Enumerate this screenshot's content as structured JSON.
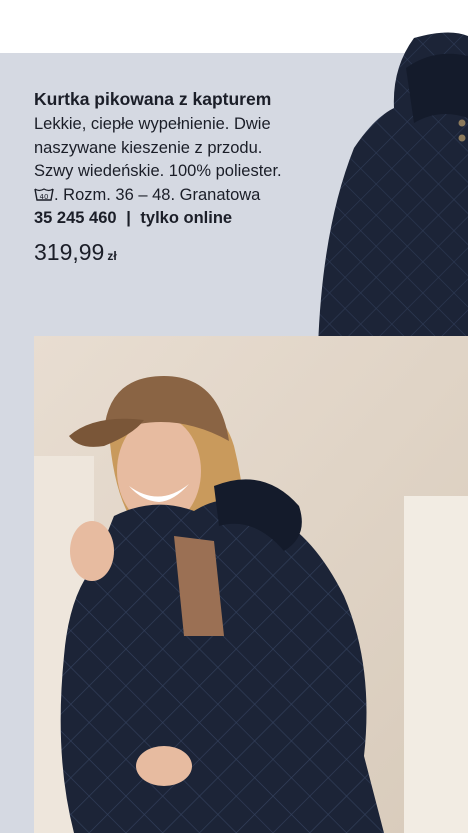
{
  "product": {
    "title": "Kurtka pikowana z kapturem",
    "description_lines": [
      "Lekkie, ciepłe wypełnienie. Dwie",
      "naszywane kieszenie z przodu.",
      "Szwy wiedeńskie. 100% poliester."
    ],
    "care_suffix": ". Rozm. 36 – 48. Granatowa",
    "wash_temp": "40",
    "code": "35 245 460",
    "separator": "|",
    "availability": "tylko online",
    "price": "319,99",
    "currency": "zł"
  },
  "colors": {
    "panel": "#d5d9e2",
    "jacket": "#1c2437",
    "cap": "#8a6444"
  }
}
